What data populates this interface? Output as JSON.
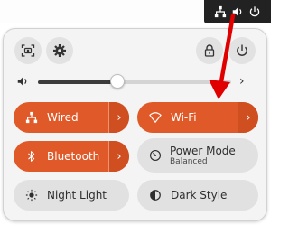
{
  "top_bar": {
    "tray_icons": [
      "network-wired-icon",
      "volume-icon",
      "power-icon"
    ],
    "tray_color": "#222222"
  },
  "header_buttons": [
    "screenshot-icon",
    "settings-gear-icon",
    "lock-icon",
    "power-icon"
  ],
  "volume": {
    "icon": "volume-icon",
    "level_fraction": 0.41
  },
  "tiles": {
    "wired": {
      "label": "Wired",
      "active": true
    },
    "wifi": {
      "label": "Wi-Fi",
      "active": true
    },
    "bluetooth": {
      "label": "Bluetooth",
      "active": true
    },
    "power_mode": {
      "label": "Power Mode",
      "subtitle": "Balanced",
      "active": false
    },
    "night_light": {
      "label": "Night Light",
      "active": false
    },
    "dark_style": {
      "label": "Dark Style",
      "active": false
    }
  },
  "colors": {
    "accent": "#e05a29",
    "annotation_arrow": "#e00000",
    "tile_off": "#e1e1e1"
  }
}
